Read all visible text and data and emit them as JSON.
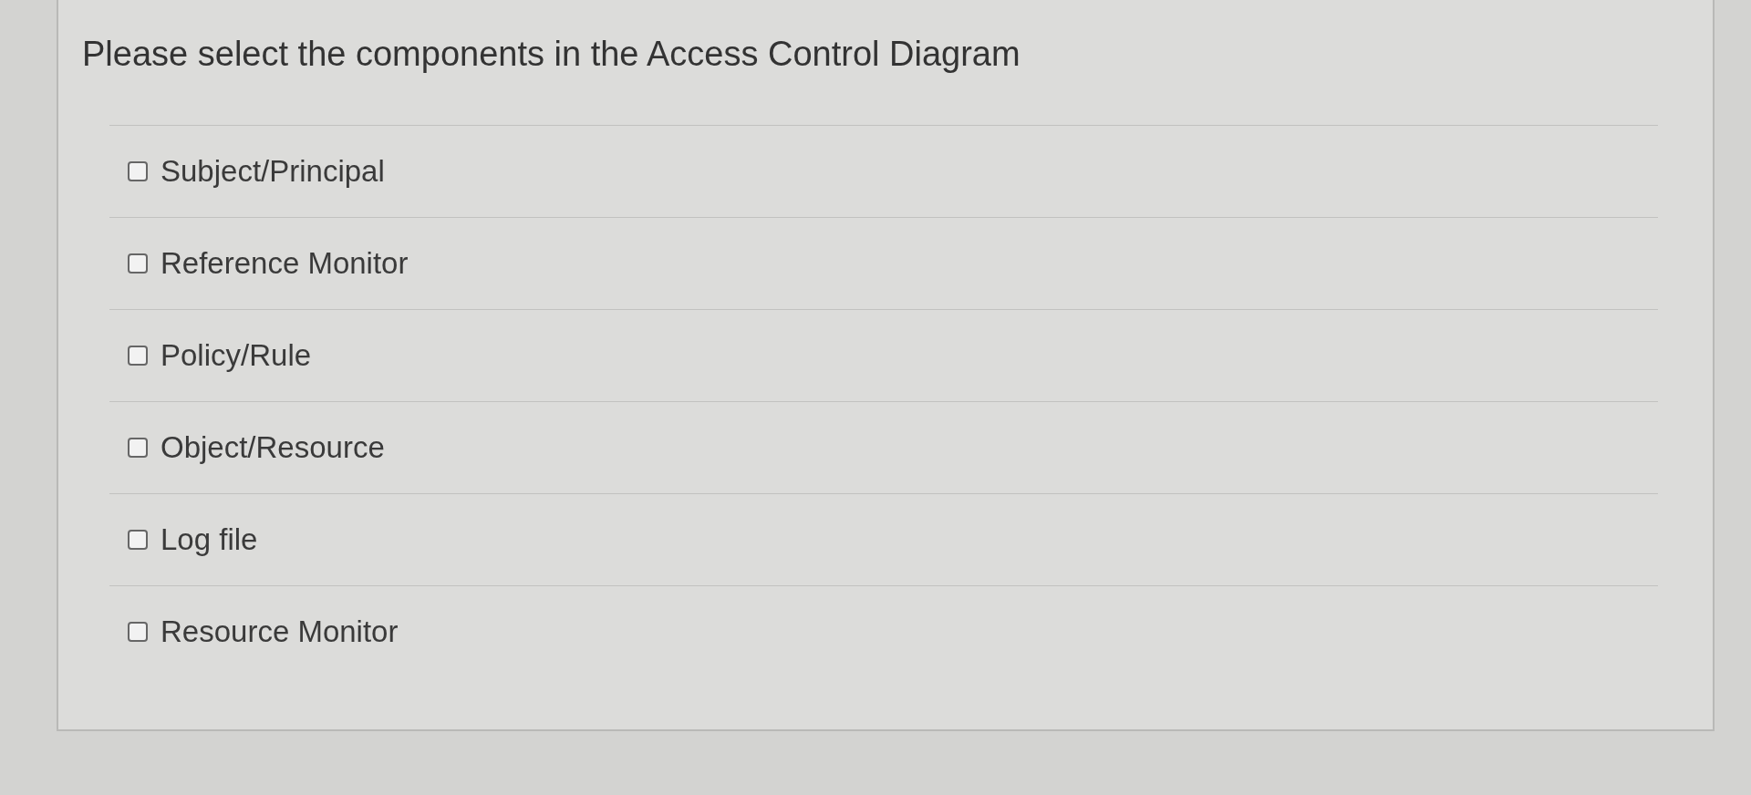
{
  "question": {
    "prompt": "Please select the components in the Access Control Diagram",
    "options": [
      {
        "label": "Subject/Principal",
        "checked": false
      },
      {
        "label": "Reference Monitor",
        "checked": false
      },
      {
        "label": "Policy/Rule",
        "checked": false
      },
      {
        "label": "Object/Resource",
        "checked": false
      },
      {
        "label": "Log file",
        "checked": false
      },
      {
        "label": "Resource Monitor",
        "checked": false
      }
    ]
  }
}
